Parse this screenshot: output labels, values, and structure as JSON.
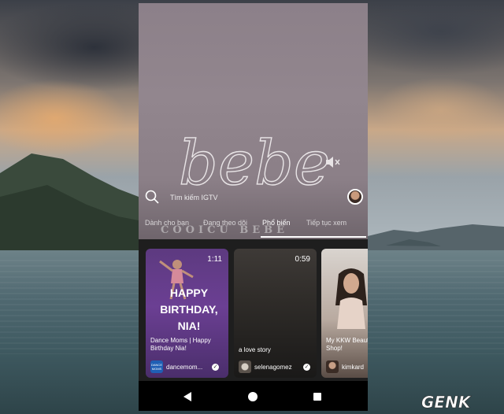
{
  "search": {
    "placeholder": "Tìm kiếm IGTV"
  },
  "hero": {
    "logo_text": "bebe"
  },
  "tabs": [
    {
      "label": "Dành cho bạn",
      "active": false
    },
    {
      "label": "Đang theo dõi",
      "active": false
    },
    {
      "label": "Phổ biến",
      "active": true
    },
    {
      "label": "Tiếp tục xem",
      "active": false
    }
  ],
  "watermark": "COOICU BEBE",
  "videos": [
    {
      "duration": "1:11",
      "overlay_text": [
        "HAPPY",
        "BIRTHDAY,",
        "NIA!"
      ],
      "title": "Dance Moms | Happy Birthday Nia!",
      "channel": "dancemom...",
      "channel_logo_text": "DANCE MOMS",
      "verified": true
    },
    {
      "duration": "0:59",
      "title": "a love story",
      "channel": "selenagomez",
      "verified": true
    },
    {
      "duration": "",
      "title": "My KKW Beauty Shop!",
      "channel": "kimkard",
      "verified": false
    }
  ],
  "colors": {
    "hero_bg": "#8c8089",
    "card_purple": "#6b3f93",
    "genk_red": "#e2231a"
  },
  "site_logo": "GENK"
}
